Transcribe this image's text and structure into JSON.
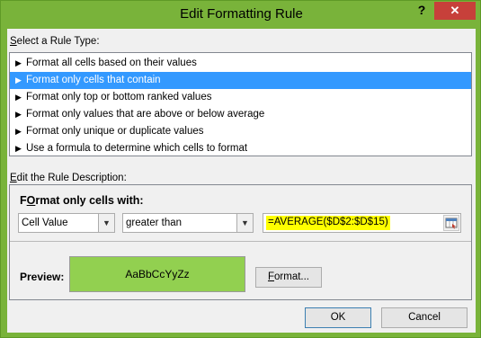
{
  "window": {
    "title": "Edit Formatting Rule",
    "help_label": "?",
    "close_label": "✕"
  },
  "rule_type": {
    "label_accel": "S",
    "label_rest": "elect a Rule Type:",
    "items": [
      {
        "label": "Format all cells based on their values"
      },
      {
        "label": "Format only cells that contain",
        "selected": true
      },
      {
        "label": "Format only top or bottom ranked values"
      },
      {
        "label": "Format only values that are above or below average"
      },
      {
        "label": "Format only unique or duplicate values"
      },
      {
        "label": "Use a formula to determine which cells to format"
      }
    ]
  },
  "description": {
    "label_accel": "E",
    "label_rest": "dit the Rule Description:",
    "format_title_accel": "O",
    "format_title_pre": "F",
    "format_title_rest": "rmat only cells with:",
    "cell_value_select": "Cell Value",
    "operator_select": "greater than",
    "formula_value": "=AVERAGE($D$2:$D$15)",
    "preview_label": "Preview:",
    "preview_sample": "AaBbCcYyZz",
    "preview_fill_color": "#92d050",
    "format_button_accel": "F",
    "format_button_rest": "ormat..."
  },
  "buttons": {
    "ok_label": "OK",
    "cancel_label": "Cancel"
  }
}
